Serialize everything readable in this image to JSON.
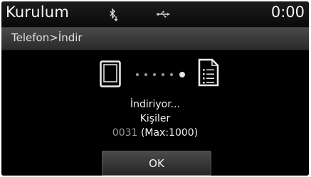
{
  "statusbar": {
    "title": "Kurulum",
    "clock": "0:00",
    "icons": [
      "bluetooth-download-icon",
      "usb-icon"
    ]
  },
  "breadcrumb": "Telefon>İndir",
  "transfer": {
    "icons": [
      "phone-icon",
      "progress-dots-icon",
      "document-icon"
    ],
    "dots_total": 6,
    "dots_active_index": 5
  },
  "message": {
    "status": "İndiriyor...",
    "item": "Kişiler",
    "count_current": "0031",
    "count_max": "(Max:1000)"
  },
  "buttons": {
    "ok": "OK"
  }
}
